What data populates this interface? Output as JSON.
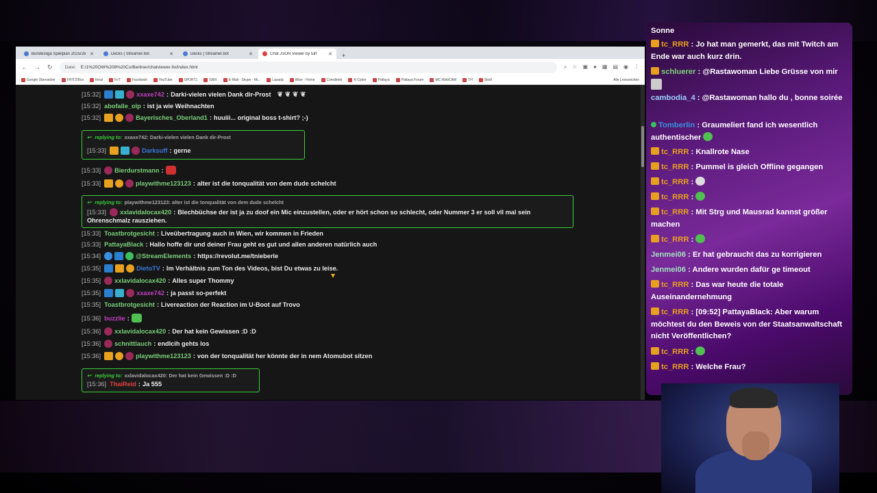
{
  "browser": {
    "tabs": [
      {
        "label": "Bundesliga Spielplan 2025/26",
        "active": false
      },
      {
        "label": "Decks | Streamer.bot",
        "active": false
      },
      {
        "label": "Decks | Streamer.bot",
        "active": false
      },
      {
        "label": "Chat JSON Viewer by tuff",
        "active": true
      }
    ],
    "url_prefix": "Datei",
    "url": "E:/1%20OW%208%20Co/Berliner/chatviewer-fix/index.html",
    "bookmarks": [
      "Google Übersetzer",
      "FRITZ!Box",
      "fonal",
      "FoT",
      "Facebook",
      "YouTube",
      "SPORT1",
      "GMX",
      "E-Mail - Skype - Mi...",
      "Lazada",
      "Wise - Home",
      "Comdirekt",
      "K-Cyber",
      "Pattaya",
      "Pattaya Forum",
      "MC-WebCAM",
      "TH",
      "Skrill"
    ],
    "bookmarks_right": "Alle Lesezeichen"
  },
  "chat": {
    "messages": [
      {
        "ts": "[15:32]",
        "user": "xxaxe742",
        "color": "#c040c0",
        "text": "Darki-vielen vielen Dank dir-Prost",
        "badges": [
          "vip",
          "sub",
          "ball"
        ],
        "leaves": true
      },
      {
        "ts": "[15:32]",
        "user": "abofalle_olp",
        "color": "#7ad07a",
        "text": "ist ja wie Weihnachten",
        "badges": []
      },
      {
        "ts": "[15:32]",
        "user": "Bayerisches_Oberland1",
        "color": "#7ad07a",
        "text": "huuiii... original boss t-shirt? ;-)",
        "badges": [
          "crown",
          "gift",
          "ball"
        ]
      },
      {
        "ts": "[15:33]",
        "user": "Darksuff",
        "color": "#3a7ae0",
        "text": "gerne",
        "badges": [
          "crown",
          "sub",
          "ball"
        ]
      },
      {
        "ts": "[15:33]",
        "user": "Bierdurstmann",
        "color": "#7ad07a",
        "text": "",
        "badges": [
          "ball"
        ],
        "emote": "red"
      },
      {
        "ts": "[15:33]",
        "user": "playwithme123123",
        "color": "#7ad07a",
        "text": "alter ist die tonqualität von dem dude schelcht",
        "badges": [
          "crown",
          "gift",
          "ball"
        ]
      },
      {
        "ts": "[15:33]",
        "user": "xxlavidalocax420",
        "color": "#7ad07a",
        "text": "Blechbüchse der ist ja zu doof ein Mic einzustellen, oder er hört schon so schlecht, oder Nummer 3 er soll vll mal sein",
        "text2": "Ohrenschmalz rausziehen.",
        "badges": [
          "ball"
        ]
      },
      {
        "ts": "[15:33]",
        "user": "Toastbrotgesicht",
        "color": "#7ad07a",
        "text": "Liveübertragung auch in Wien, wir kommen in Frieden",
        "badges": []
      },
      {
        "ts": "[15:33]",
        "user": "PattayaBlack",
        "color": "#7ad07a",
        "text": "Hallo hoffe dir und deiner Frau geht es gut und allen anderen natürlich auch",
        "badges": []
      },
      {
        "ts": "[15:34]",
        "user": "@StreamElements",
        "color": "#7ad07a",
        "text": "https://revolut.me/tnieberle",
        "badges": [
          "blue",
          "vip",
          "green"
        ]
      },
      {
        "ts": "[15:35]",
        "user": "DietoTV",
        "color": "#3a7ae0",
        "text": "Im Verhältnis zum Ton des Videos, bist Du etwas zu leise.",
        "badges": [
          "vip",
          "crown",
          "gift"
        ]
      },
      {
        "ts": "[15:35]",
        "user": "xxlavidalocax420",
        "color": "#7ad07a",
        "text": "Alles super Thommy",
        "badges": [
          "ball"
        ]
      },
      {
        "ts": "[15:35]",
        "user": "xxaxe742",
        "color": "#c040c0",
        "text": "ja passt so-perfekt",
        "badges": [
          "vip",
          "sub",
          "ball"
        ]
      },
      {
        "ts": "[15:35]",
        "user": "Toastbrotgesicht",
        "color": "#7ad07a",
        "text": "Livereaction der Reaction im U-Boot auf Trovo",
        "badges": []
      },
      {
        "ts": "[15:36]",
        "user": "buzzlie",
        "color": "#c040c0",
        "text": "",
        "badges": [],
        "emote": "green"
      },
      {
        "ts": "[15:36]",
        "user": "xxlavidalocax420",
        "color": "#7ad07a",
        "text": "Der hat kein Gewissen :D :D",
        "badges": [
          "ball"
        ]
      },
      {
        "ts": "[15:36]",
        "user": "schnittlauch",
        "color": "#7ad07a",
        "text": "endlcih gehts los",
        "badges": [
          "ball"
        ]
      },
      {
        "ts": "[15:36]",
        "user": "playwithme123123",
        "color": "#7ad07a",
        "text": "von der tonqualität her könnte der in nem Atomubot sitzen",
        "badges": [
          "crown",
          "gift",
          "ball"
        ]
      },
      {
        "ts": "[15:36]",
        "user": "ThaiReid",
        "color": "#e04040",
        "text": "Ja 555",
        "badges": []
      }
    ],
    "replies": [
      {
        "label": "replying to:",
        "text": "xxaxe742: Darki-vielen vielen Dank dir-Prost"
      },
      {
        "label": "replying to:",
        "text": "playwithme123123: alter ist die tonqualität von dem dude schelcht"
      },
      {
        "label": "replying to:",
        "text": "xxlavidalocax420: Der hat kein Gewissen :D :D"
      }
    ]
  },
  "overlay": {
    "lines": [
      {
        "user": "",
        "text": "Sonne",
        "icon": "none"
      },
      {
        "user": "tc_RRR",
        "color": "#e8a020",
        "text": "Jo hat man gemerkt, das mit Twitch am Ende war auch kurz drin.",
        "icon": "crown"
      },
      {
        "user": "schluerer",
        "color": "#7ad07a",
        "text": "@Rastawoman Liebe Grüsse von mir",
        "icon": "crown"
      },
      {
        "user": "cambodia_4",
        "color": "#9ad0ff",
        "text": "@Rastawoman hallo du , bonne soirée",
        "icon": "none"
      },
      {
        "user": "Tomberlin",
        "color": "#3a90e0",
        "text": "Graumeliert fand ich wesentlich authentischer",
        "icon": "dot"
      },
      {
        "user": "tc_RRR",
        "color": "#e8a020",
        "text": "Knallrote Nase",
        "icon": "crown"
      },
      {
        "user": "tc_RRR",
        "color": "#e8a020",
        "text": "Pummel is gleich Offline gegangen",
        "icon": "crown"
      },
      {
        "user": "tc_RRR",
        "color": "#e8a020",
        "text": "",
        "icon": "crown"
      },
      {
        "user": "tc_RRR",
        "color": "#e8a020",
        "text": "",
        "icon": "crown"
      },
      {
        "user": "tc_RRR",
        "color": "#e8a020",
        "text": "Mit Strg und Mausrad kannst größer machen",
        "icon": "crown"
      },
      {
        "user": "tc_RRR",
        "color": "#e8a020",
        "text": "",
        "icon": "crown"
      },
      {
        "user": "Jenmei06",
        "color": "#a0e0c0",
        "text": "Er hat gebraucht das zu korrigieren",
        "icon": "none"
      },
      {
        "user": "Jenmei06",
        "color": "#a0e0c0",
        "text": "Andere wurden dafür ge timeout",
        "icon": "none"
      },
      {
        "user": "tc_RRR",
        "color": "#e8a020",
        "text": "Das war heute die totale Auseinandernehmung",
        "icon": "crown"
      },
      {
        "user": "tc_RRR",
        "color": "#e8a020",
        "text": "[09:52] PattayaBlack: Aber warum möchtest du den Beweis von der Staatsanwaltschaft nicht Veröffentlichen?",
        "icon": "crown"
      },
      {
        "user": "tc_RRR",
        "color": "#e8a020",
        "text": "",
        "icon": "crown"
      },
      {
        "user": "tc_RRR",
        "color": "#e8a020",
        "text": "Welche Frau?",
        "icon": "crown"
      }
    ]
  }
}
